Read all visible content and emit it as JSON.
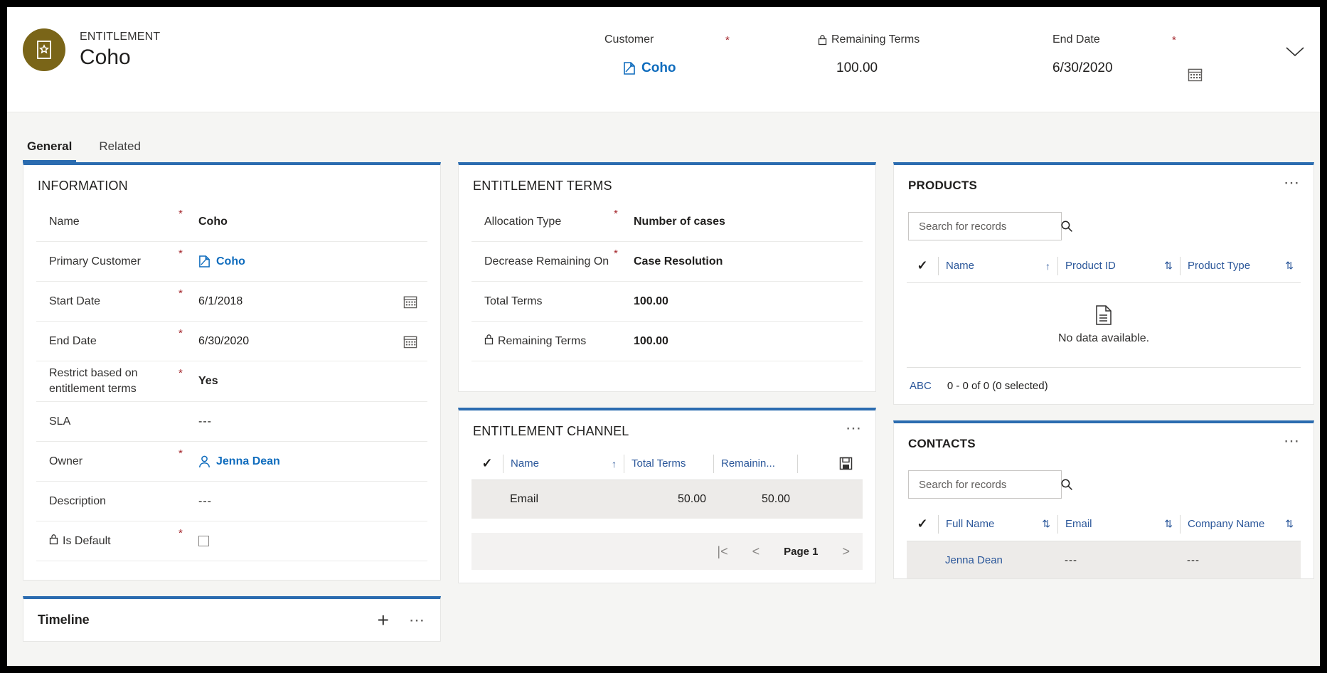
{
  "header": {
    "entity_kicker": "ENTITLEMENT",
    "entity_title": "Coho",
    "avatar_icon": "entitlement-icon",
    "fields": {
      "customer": {
        "label": "Customer",
        "value": "Coho",
        "required": "*"
      },
      "remaining_terms": {
        "label": "Remaining Terms",
        "value": "100.00",
        "locked": true
      },
      "end_date": {
        "label": "End Date",
        "value": "6/30/2020",
        "required": "*"
      }
    },
    "chevron_icon": "chevron-down-icon"
  },
  "tabs": [
    {
      "label": "General",
      "active": true
    },
    {
      "label": "Related",
      "active": false
    }
  ],
  "information": {
    "title": "INFORMATION",
    "fields": [
      {
        "label": "Name",
        "required": "*",
        "value": "Coho",
        "style": "bold"
      },
      {
        "label": "Primary Customer",
        "required": "*",
        "value": "Coho",
        "style": "link",
        "icon": "account-icon"
      },
      {
        "label": "Start Date",
        "required": "*",
        "value": "6/1/2018",
        "icon_right": "calendar-icon"
      },
      {
        "label": "End Date",
        "required": "*",
        "value": "6/30/2020",
        "icon_right": "calendar-icon"
      },
      {
        "label": "Restrict based on entitlement terms",
        "required": "*",
        "value": "Yes",
        "style": "bold"
      },
      {
        "label": "SLA",
        "required": "",
        "value": "---",
        "style": "muted"
      },
      {
        "label": "Owner",
        "required": "*",
        "value": "Jenna Dean",
        "style": "link",
        "icon": "user-icon"
      },
      {
        "label": "Description",
        "required": "",
        "value": "---",
        "style": "muted"
      },
      {
        "label": "Is Default",
        "required": "*",
        "value": "",
        "style": "checkbox",
        "locked": true
      }
    ]
  },
  "timeline": {
    "title": "Timeline",
    "add_icon": "plus-icon",
    "more_icon": "more-icon"
  },
  "entitlement_terms": {
    "title": "ENTITLEMENT TERMS",
    "fields": [
      {
        "label": "Allocation Type",
        "required": "*",
        "value": "Number of cases",
        "style": "bold"
      },
      {
        "label": "Decrease Remaining On",
        "required": "*",
        "value": "Case Resolution",
        "style": "bold"
      },
      {
        "label": "Total Terms",
        "required": "",
        "value": "100.00",
        "style": "bold"
      },
      {
        "label": "Remaining Terms",
        "required": "",
        "value": "100.00",
        "style": "bold",
        "locked": true
      }
    ]
  },
  "entitlement_channel": {
    "title": "ENTITLEMENT CHANNEL",
    "more_icon": "more-icon",
    "save_icon": "save-icon",
    "columns": [
      {
        "label": "Name",
        "sort": "ascending"
      },
      {
        "label": "Total Terms",
        "sort": "none"
      },
      {
        "label": "Remainin...",
        "sort": "none"
      }
    ],
    "rows": [
      {
        "name": "Email",
        "total_terms": "50.00",
        "remaining_terms": "50.00"
      }
    ],
    "pagination": {
      "first_label": "|<",
      "prev_label": "<",
      "page_label": "Page 1",
      "next_label": ">"
    }
  },
  "products": {
    "title": "PRODUCTS",
    "more_icon": "more-icon",
    "search_placeholder": "Search for records",
    "search_value": "",
    "columns": [
      {
        "label": "Name",
        "sort": "ascending"
      },
      {
        "label": "Product ID",
        "sort": "none"
      },
      {
        "label": "Product Type",
        "sort": "none"
      }
    ],
    "empty_text": "No data available.",
    "empty_icon": "document-icon",
    "footer": {
      "alpha_label": "ABC",
      "count_text": "0 - 0 of 0 (0 selected)"
    }
  },
  "contacts": {
    "title": "CONTACTS",
    "more_icon": "more-icon",
    "search_placeholder": "Search for records",
    "search_value": "",
    "columns": [
      {
        "label": "Full Name",
        "sort": "none"
      },
      {
        "label": "Email",
        "sort": "none"
      },
      {
        "label": "Company Name",
        "sort": "none"
      }
    ],
    "rows": [
      {
        "full_name": "Jenna Dean",
        "email": "---",
        "company_name": "---"
      }
    ]
  },
  "colors": {
    "accent": "#2b6cb0",
    "link": "#2b579a",
    "required": "#a4262c",
    "avatar": "#7a6518",
    "row_selected": "#edebe9"
  }
}
